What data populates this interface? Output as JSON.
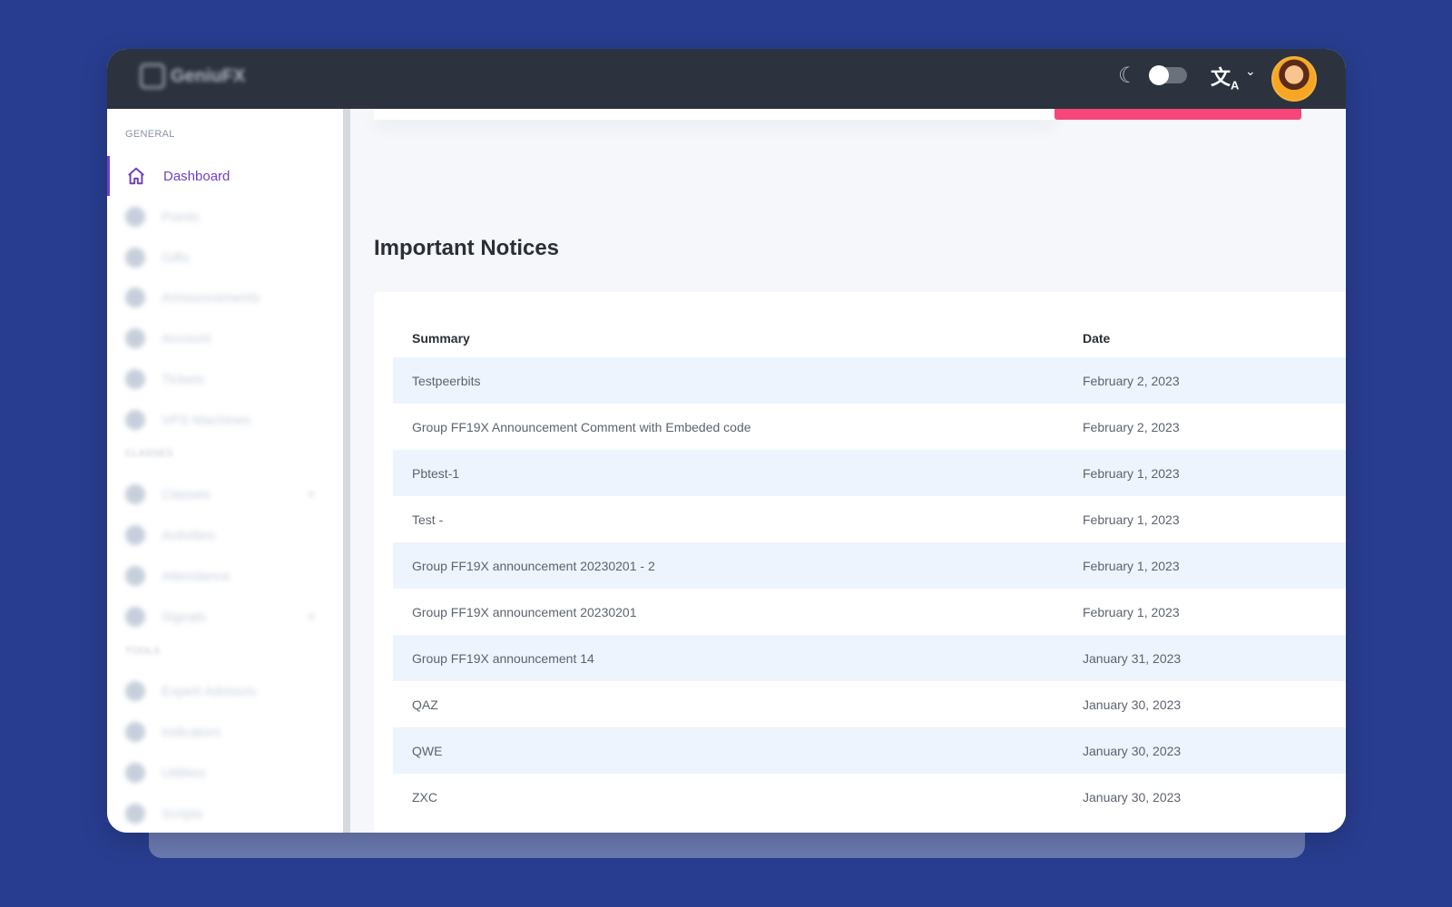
{
  "topbar": {
    "logo_text": "GeniuFX",
    "theme_icon": "moon-icon",
    "theme_toggle_on": false,
    "language_icon": "translate-icon"
  },
  "sidebar": {
    "section_general": "GENERAL",
    "items": [
      {
        "label": "Dashboard",
        "icon": "home-icon",
        "active": true
      },
      {
        "label": "Points",
        "icon": "globe-icon"
      },
      {
        "label": "Gifts",
        "icon": "gift-icon"
      },
      {
        "label": "Announcements",
        "icon": "info-icon"
      },
      {
        "label": "Account",
        "icon": "user-icon"
      },
      {
        "label": "Tickets",
        "icon": "ticket-icon"
      },
      {
        "label": "VPS Machines",
        "icon": "monitor-icon"
      }
    ],
    "section_classes": "CLASSES",
    "items2": [
      {
        "label": "Classes",
        "icon": "school-icon"
      },
      {
        "label": "Activities",
        "icon": "activity-icon"
      },
      {
        "label": "Attendance",
        "icon": "attendance-icon"
      },
      {
        "label": "Signals",
        "icon": "signal-icon"
      }
    ],
    "section_tools": "TOOLS",
    "items3": [
      {
        "label": "Expert Advisors",
        "icon": "robot-icon"
      },
      {
        "label": "Indicators",
        "icon": "chart-icon"
      },
      {
        "label": "Utilities",
        "icon": "tools-icon"
      },
      {
        "label": "Scripts",
        "icon": "script-icon"
      }
    ]
  },
  "main": {
    "title": "Important Notices",
    "table": {
      "headers": {
        "summary": "Summary",
        "date": "Date"
      },
      "rows": [
        {
          "summary": "Testpeerbits",
          "date": "February 2, 2023"
        },
        {
          "summary": "Group FF19X Announcement Comment with Embeded code",
          "date": "February 2, 2023"
        },
        {
          "summary": "Pbtest-1",
          "date": "February 1, 2023"
        },
        {
          "summary": "Test -",
          "date": "February 1, 2023"
        },
        {
          "summary": "Group FF19X announcement 20230201 - 2",
          "date": "February 1, 2023"
        },
        {
          "summary": "Group FF19X announcement 20230201",
          "date": "February 1, 2023"
        },
        {
          "summary": "Group FF19X announcement 14",
          "date": "January 31, 2023"
        },
        {
          "summary": "QAZ",
          "date": "January 30, 2023"
        },
        {
          "summary": "QWE",
          "date": "January 30, 2023"
        },
        {
          "summary": "ZXC",
          "date": "January 30, 2023"
        }
      ]
    }
  },
  "colors": {
    "background": "#283d8f",
    "topbar": "#2c333f",
    "accent": "#6f42c1",
    "pink": "#f7467a",
    "row_stripe": "#edf4fd"
  }
}
